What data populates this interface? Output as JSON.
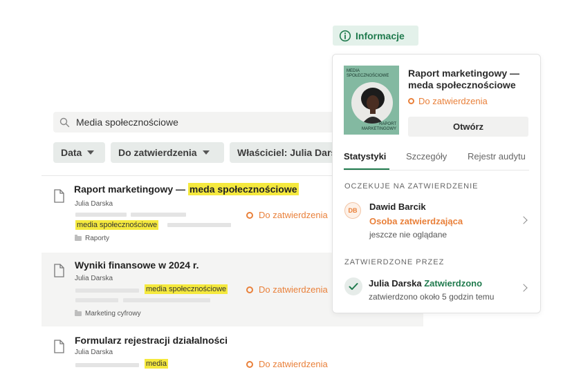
{
  "search": {
    "value": "Media społecznościowe",
    "icon": "search-icon"
  },
  "filters": [
    {
      "label": "Data"
    },
    {
      "label": "Do zatwierdzenia"
    },
    {
      "label": "Właściciel: Julia Darska"
    }
  ],
  "documents": [
    {
      "title_prefix": "Raport marketingowy — ",
      "title_highlight": "meda społecznościowe",
      "author": "Julia Darska",
      "tag": "media społecznościowe",
      "folder": "Raporty",
      "status": "Do zatwierdzenia"
    },
    {
      "title": "Wyniki finansowe w 2024 r.",
      "author": "Julia Darska",
      "tag": "media społecznościowe",
      "folder": "Marketing cyfrowy",
      "status": "Do zatwierdzenia"
    },
    {
      "title": "Formularz rejestracji działalności",
      "author": "Julia Darska",
      "tag": "media",
      "status": "Do zatwierdzenia"
    }
  ],
  "info_tab": {
    "label": "Informacje",
    "icon": "info-icon"
  },
  "panel": {
    "cover": {
      "top_text_1": "MEDIA",
      "top_text_2": "SPOŁECZNOŚCIOWE",
      "bottom_text_1": "RAPORT",
      "bottom_text_2": "MARKETINGOWY"
    },
    "doc_title": "Raport marketingowy — meda społecznościowe",
    "status": "Do zatwierdzenia",
    "open_button": "Otwórz",
    "tabs": [
      {
        "label": "Statystyki"
      },
      {
        "label": "Szczegóły"
      },
      {
        "label": "Rejestr audytu"
      }
    ],
    "pending_header": "OCZEKUJE NA ZATWIERDZENIE",
    "pending": {
      "initials": "DB",
      "name": "Dawid Barcik",
      "role": "Osoba zatwierdzająca",
      "note": "jeszcze nie oglądane"
    },
    "approved_header": "ZATWIERDZONE PRZEZ",
    "approved": {
      "name": "Julia Darska",
      "status": "Zatwierdzono",
      "note": "zatwierdzono około 5 godzin temu"
    }
  },
  "colors": {
    "accent_green": "#1f7a4d",
    "status_orange": "#e9803a",
    "highlight_yellow": "#f5e93e",
    "cover_green": "#83b9a1"
  }
}
